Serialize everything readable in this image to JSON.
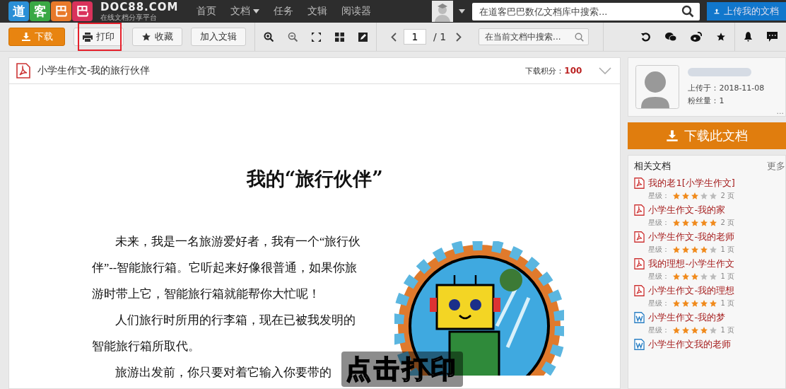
{
  "topbar": {
    "logo_chars": [
      "道",
      "客",
      "巴",
      "巴"
    ],
    "logo_name": "DOC88.COM",
    "logo_tagline": "在线文档分享平台",
    "nav": [
      {
        "label": "首页",
        "dropdown": false
      },
      {
        "label": "文档",
        "dropdown": true
      },
      {
        "label": "任务",
        "dropdown": false
      },
      {
        "label": "文辑",
        "dropdown": false
      },
      {
        "label": "阅读器",
        "dropdown": false
      }
    ],
    "search": {
      "placeholder": "在道客巴巴数亿文档库中搜索..."
    },
    "upload_button": "上传我的文档"
  },
  "toolbar": {
    "buttons": [
      {
        "label": "下载",
        "kind": "download",
        "highlighted": false
      },
      {
        "label": "打印",
        "kind": "print",
        "highlighted": true
      },
      {
        "label": "收藏",
        "kind": "favorite",
        "highlighted": false
      },
      {
        "label": "加入文辑",
        "kind": "plain",
        "highlighted": false
      }
    ],
    "page": {
      "value": "1",
      "total": "/ 1"
    },
    "doc_search": {
      "placeholder": "在当前文档中搜索..."
    }
  },
  "document": {
    "title": "小学生作文-我的旅行伙伴",
    "points_label": "下载积分：",
    "points": "100",
    "heading": "我的“旅行伙伴”",
    "paragraphs": [
      "未来，我是一名旅游爱好者，我有一个“旅行伙伴”--智能旅行箱。它听起来好像很普通，如果你旅游时带上它，智能旅行箱就能帮你大忙呢！",
      "人们旅行时所用的行李箱，现在已被我发明的智能旅行箱所取代。",
      "旅游出发前，你只要对着它输入你要带的"
    ],
    "caption": "点击打印"
  },
  "sidebar": {
    "uploaded": "上传于：2018-11-08",
    "followers": "粉丝量：1",
    "more_dots": "...",
    "download_button": "下载此文档",
    "related": {
      "title": "相关文档",
      "more": "更多",
      "items": [
        {
          "title": "我的老1[小学生作文]",
          "kind": "pdf",
          "stars_label": "星级：",
          "stars": 3,
          "pages": "2 页"
        },
        {
          "title": "小学生作文-我的家",
          "kind": "pdf",
          "stars_label": "星级：",
          "stars": 5,
          "pages": "2 页"
        },
        {
          "title": "小学生作文-我的老师",
          "kind": "pdf",
          "stars_label": "星级：",
          "stars": 4,
          "pages": "1 页"
        },
        {
          "title": "我的理想-小学生作文",
          "kind": "pdf",
          "stars_label": "星级：",
          "stars": 3,
          "pages": "1 页"
        },
        {
          "title": "小学生作文-我的理想",
          "kind": "pdf",
          "stars_label": "星级：",
          "stars": 5,
          "pages": "1 页"
        },
        {
          "title": "小学生作文-我的梦",
          "kind": "word",
          "stars_label": "星级：",
          "stars": 4,
          "pages": "1 页"
        },
        {
          "title": "小学生作文我的老师",
          "kind": "word"
        }
      ]
    }
  }
}
